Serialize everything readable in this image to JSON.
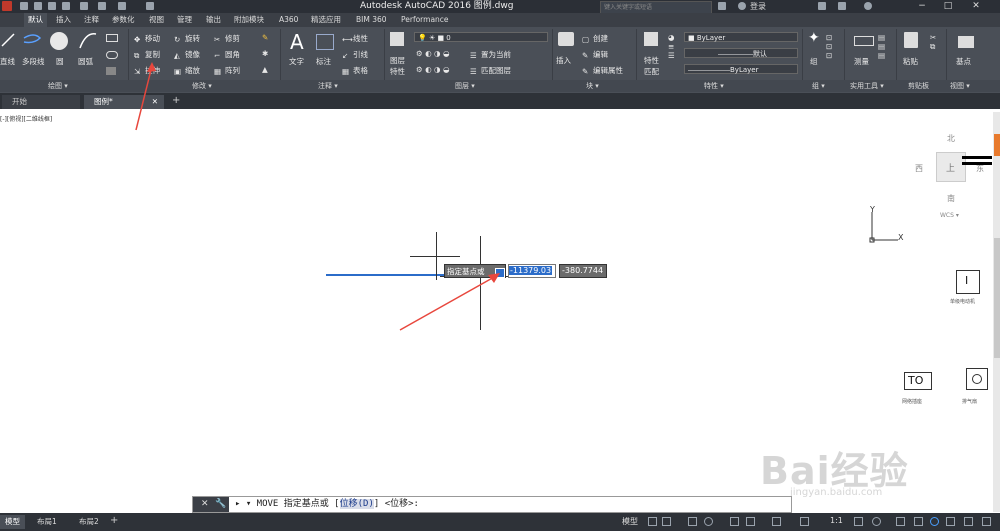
{
  "window": {
    "title": "Autodesk AutoCAD 2016    图例.dwg",
    "search_placeholder": "键入关键字或短语",
    "signin": "登录"
  },
  "ribbon_tabs": [
    "默认",
    "插入",
    "注释",
    "参数化",
    "视图",
    "管理",
    "输出",
    "附加模块",
    "A360",
    "精选应用",
    "BIM 360",
    "Performance"
  ],
  "ribbon": {
    "draw": {
      "line": "直线",
      "polyline": "多段线",
      "circle": "圆",
      "arc": "圆弧"
    },
    "modify": {
      "move": "移动",
      "rotate": "旋转",
      "trim": "修剪",
      "copy": "复制",
      "mirror": "镜像",
      "fillet": "圆角",
      "stretch": "拉伸",
      "scale": "缩放",
      "array": "阵列"
    },
    "annotation": {
      "text": "文字",
      "dimension": "标注",
      "linear": "线性",
      "leader": "引线",
      "table": "表格"
    },
    "layers": {
      "properties_l1": "图层",
      "properties_l2": "特性",
      "layer_value": "0",
      "set_current": "置为当前",
      "match_layer": "匹配图层"
    },
    "block": {
      "insert": "插入",
      "create": "创建",
      "edit": "编辑",
      "edit_attr": "编辑属性"
    },
    "properties": {
      "match_l1": "特性",
      "match_l2": "匹配",
      "color": "ByLayer",
      "lineweight": "默认",
      "linetype": "ByLayer"
    },
    "groups": {
      "group": "组"
    },
    "utilities": {
      "measure": "测量"
    },
    "clipboard": {
      "paste": "粘贴"
    },
    "view": {
      "base": "基点"
    }
  },
  "panel_titles": [
    "绘图 ▾",
    "修改 ▾",
    "注释 ▾",
    "图层 ▾",
    "块 ▾",
    "特性 ▾",
    "组 ▾",
    "实用工具 ▾",
    "剪贴板",
    "视图 ▾"
  ],
  "doc_tabs": [
    "开始",
    "图例*"
  ],
  "viewport_label": "[-][俯视][二维线框]",
  "compass": {
    "north": "北",
    "south": "南",
    "west": "西",
    "east": "东",
    "top": "上",
    "wcs": "WCS ▾"
  },
  "ucs": {
    "x": "X",
    "y": "Y"
  },
  "dynamic_input": {
    "prompt": "指定基点或",
    "x_value": "-11379.03",
    "y_value": "-380.7744"
  },
  "symbols": [
    {
      "text": "I",
      "caption": "单级电动机"
    },
    {
      "text": "TO",
      "caption": "网络插座"
    },
    {
      "text": "",
      "caption": "排气扇"
    }
  ],
  "command_line": {
    "prefix": "▸ ▾ MOVE 指定基点或 [",
    "option": "位移(D)",
    "suffix": "] <位移>:"
  },
  "status_tabs": [
    "模型",
    "布局1",
    "布局2"
  ],
  "status_right": {
    "model": "模型",
    "scale": "1:1"
  },
  "watermark": {
    "main": "Bai经验",
    "sub": "jingyan.baidu.com"
  },
  "colors": {
    "dark": "#2b2f36",
    "ribbon": "#4a4f57",
    "highlight": "#2b6cc9",
    "arrow": "#e8473d",
    "line_blue": "#2b6cc9"
  }
}
